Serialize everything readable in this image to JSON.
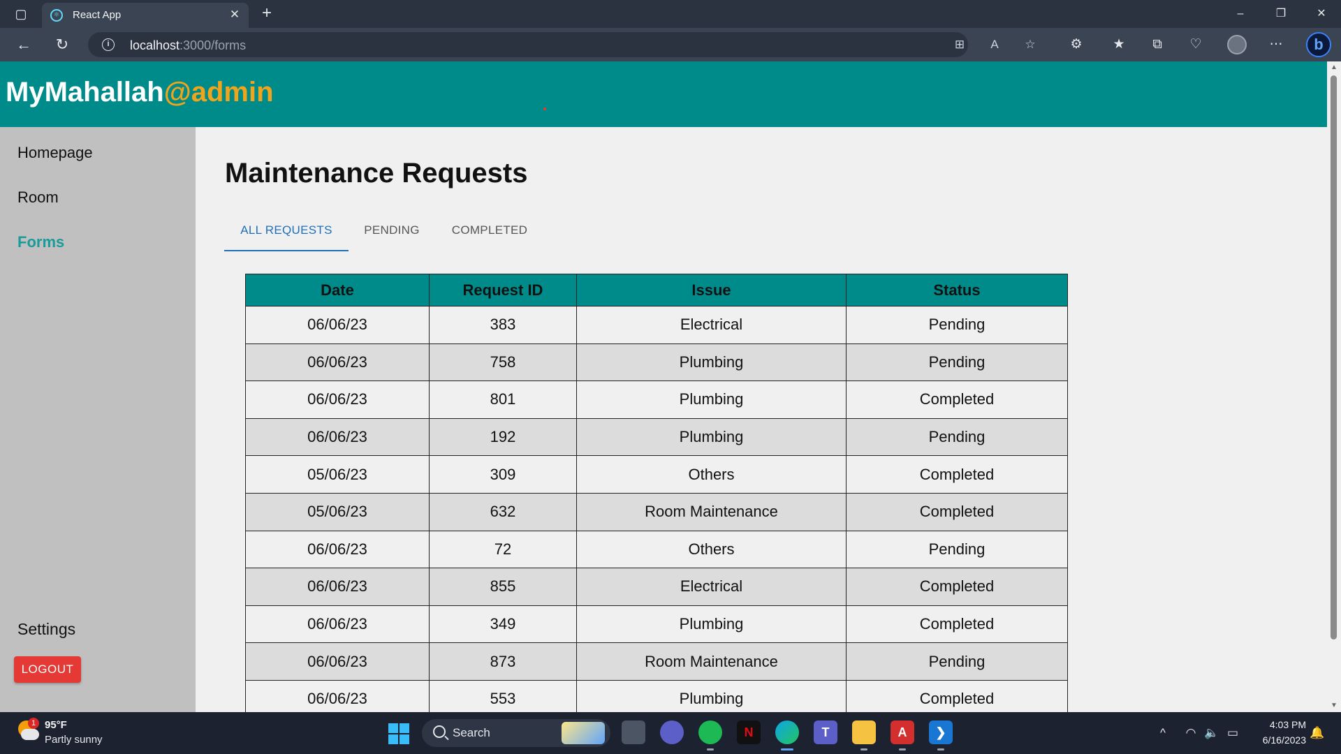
{
  "browser": {
    "tab_title": "React App",
    "url_host": "localhost",
    "url_path": ":3000/forms",
    "icons": [
      "tab-actions-icon",
      "react-favicon",
      "close-icon",
      "plus-icon",
      "minimize-icon",
      "restore-icon",
      "close-window-icon",
      "back-icon",
      "refresh-icon",
      "info-icon",
      "app-available-icon",
      "read-aloud-icon",
      "favorite-star-icon",
      "extensions-icon",
      "favorites-icon",
      "collections-icon",
      "browser-essentials-icon",
      "profile-avatar",
      "more-icon",
      "bing-chat-icon"
    ],
    "glyphs": {
      "tab_actions": "▢",
      "close": "✕",
      "plus": "+",
      "minimize": "–",
      "restore": "❐",
      "back": "←",
      "refresh": "↻",
      "info": "i",
      "app_available": "⊞",
      "read_aloud": "A",
      "star": "☆",
      "extensions": "⚙",
      "favorites": "★",
      "collections": "⧉",
      "essentials": "♡",
      "more": "⋯",
      "bing": "b"
    }
  },
  "app": {
    "brand_name": "MyMahallah",
    "brand_suffix": "@admin",
    "nav": {
      "homepage": "Homepage",
      "room": "Room",
      "forms": "Forms",
      "settings": "Settings",
      "logout": "LOGOUT"
    },
    "page_title": "Maintenance Requests",
    "tabs": {
      "all": "ALL REQUESTS",
      "pending": "PENDING",
      "completed": "COMPLETED",
      "active": "all"
    },
    "table": {
      "headers": {
        "date": "Date",
        "request_id": "Request ID",
        "issue": "Issue",
        "status": "Status"
      },
      "rows": [
        {
          "date": "06/06/23",
          "id": "383",
          "issue": "Electrical",
          "status": "Pending"
        },
        {
          "date": "06/06/23",
          "id": "758",
          "issue": "Plumbing",
          "status": "Pending"
        },
        {
          "date": "06/06/23",
          "id": "801",
          "issue": "Plumbing",
          "status": "Completed"
        },
        {
          "date": "06/06/23",
          "id": "192",
          "issue": "Plumbing",
          "status": "Pending"
        },
        {
          "date": "05/06/23",
          "id": "309",
          "issue": "Others",
          "status": "Completed"
        },
        {
          "date": "05/06/23",
          "id": "632",
          "issue": "Room Maintenance",
          "status": "Completed"
        },
        {
          "date": "06/06/23",
          "id": "72",
          "issue": "Others",
          "status": "Pending"
        },
        {
          "date": "06/06/23",
          "id": "855",
          "issue": "Electrical",
          "status": "Completed"
        },
        {
          "date": "06/06/23",
          "id": "349",
          "issue": "Plumbing",
          "status": "Completed"
        },
        {
          "date": "06/06/23",
          "id": "873",
          "issue": "Room Maintenance",
          "status": "Pending"
        },
        {
          "date": "06/06/23",
          "id": "553",
          "issue": "Plumbing",
          "status": "Completed"
        }
      ]
    },
    "colors": {
      "header_bg": "#008b8b",
      "brand_accent": "#f0a41c",
      "sidebar_bg": "#c0c0c0",
      "active_nav": "#1b9a9a",
      "active_tab": "#1e6fb8",
      "logout_bg": "#e53935"
    }
  },
  "taskbar": {
    "weather_badge": "1",
    "temperature": "95°F",
    "weather": "Partly sunny",
    "search_label": "Search",
    "apps": [
      "task-view-icon",
      "meet-icon",
      "spotify-icon",
      "netflix-icon",
      "edge-icon",
      "teams-icon",
      "file-explorer-icon",
      "acrobat-icon",
      "vscode-icon"
    ],
    "app_glyphs": {
      "netflix": "N",
      "acrobat": "A",
      "vscode": "❯",
      "teams": "T"
    },
    "tray_glyphs": {
      "chevron": "^",
      "wifi": "◠",
      "volume": "🔈",
      "battery": "▭",
      "bell": "🔔"
    },
    "time": "4:03 PM",
    "date": "6/16/2023"
  }
}
